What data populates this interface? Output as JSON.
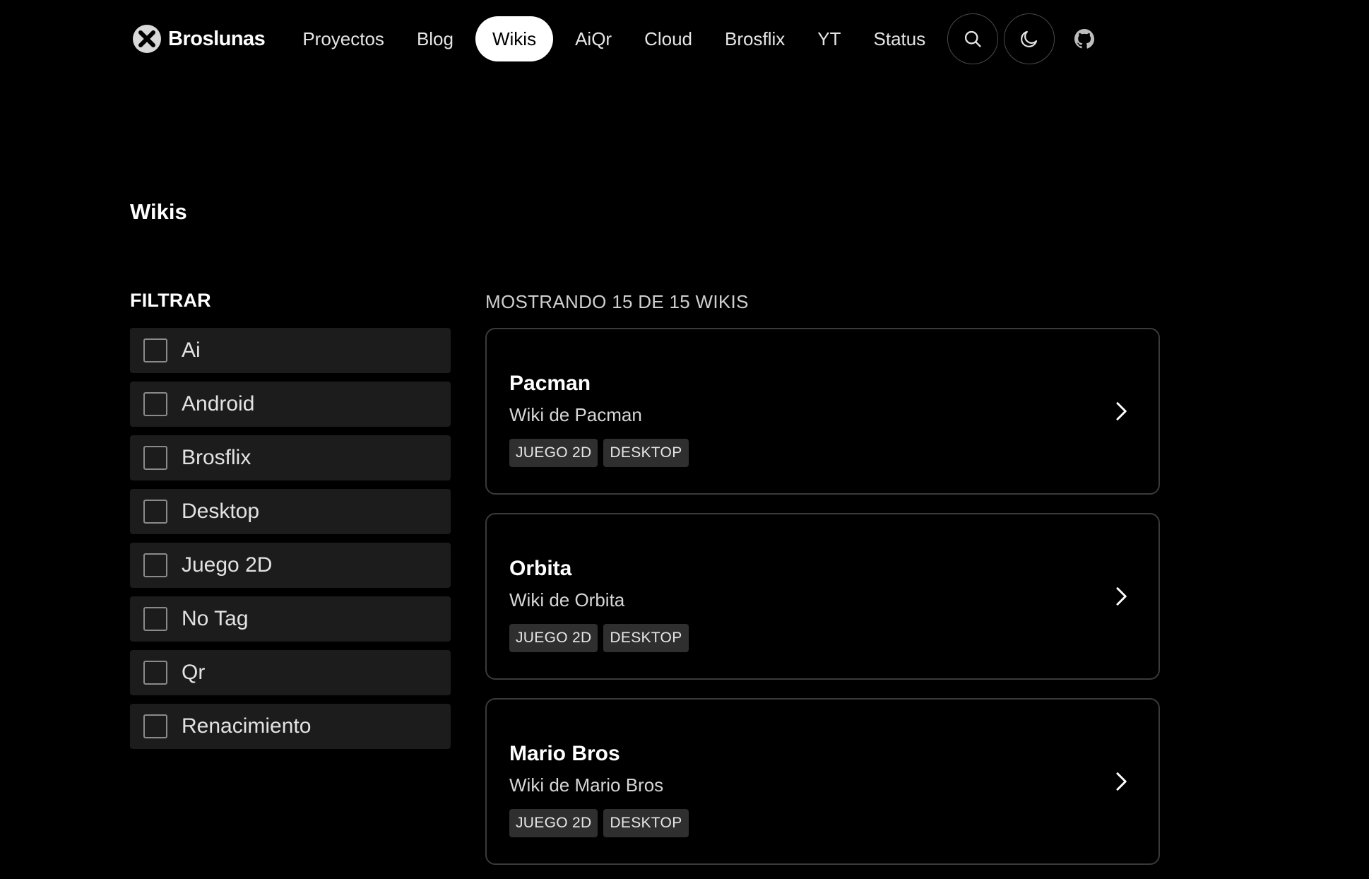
{
  "header": {
    "brand": "Broslunas",
    "nav": [
      {
        "label": "Proyectos",
        "active": false
      },
      {
        "label": "Blog",
        "active": false
      },
      {
        "label": "Wikis",
        "active": true
      },
      {
        "label": "AiQr",
        "active": false
      },
      {
        "label": "Cloud",
        "active": false
      },
      {
        "label": "Brosflix",
        "active": false
      },
      {
        "label": "YT",
        "active": false
      },
      {
        "label": "Status",
        "active": false
      }
    ],
    "icons": [
      "search-icon",
      "moon-icon",
      "github-icon"
    ]
  },
  "page": {
    "title": "Wikis"
  },
  "filter": {
    "title": "FILTRAR",
    "items": [
      {
        "label": "Ai",
        "checked": false
      },
      {
        "label": "Android",
        "checked": false
      },
      {
        "label": "Brosflix",
        "checked": false
      },
      {
        "label": "Desktop",
        "checked": false
      },
      {
        "label": "Juego 2D",
        "checked": false
      },
      {
        "label": "No Tag",
        "checked": false
      },
      {
        "label": "Qr",
        "checked": false
      },
      {
        "label": "Renacimiento",
        "checked": false
      }
    ]
  },
  "results": {
    "count_text": "MOSTRANDO 15 DE 15 WIKIS",
    "cards": [
      {
        "title": "Pacman",
        "description": "Wiki de Pacman",
        "tags": [
          "JUEGO 2D",
          "DESKTOP"
        ]
      },
      {
        "title": "Orbita",
        "description": "Wiki de Orbita",
        "tags": [
          "JUEGO 2D",
          "DESKTOP"
        ]
      },
      {
        "title": "Mario Bros",
        "description": "Wiki de Mario Bros",
        "tags": [
          "JUEGO 2D",
          "DESKTOP"
        ]
      }
    ]
  }
}
